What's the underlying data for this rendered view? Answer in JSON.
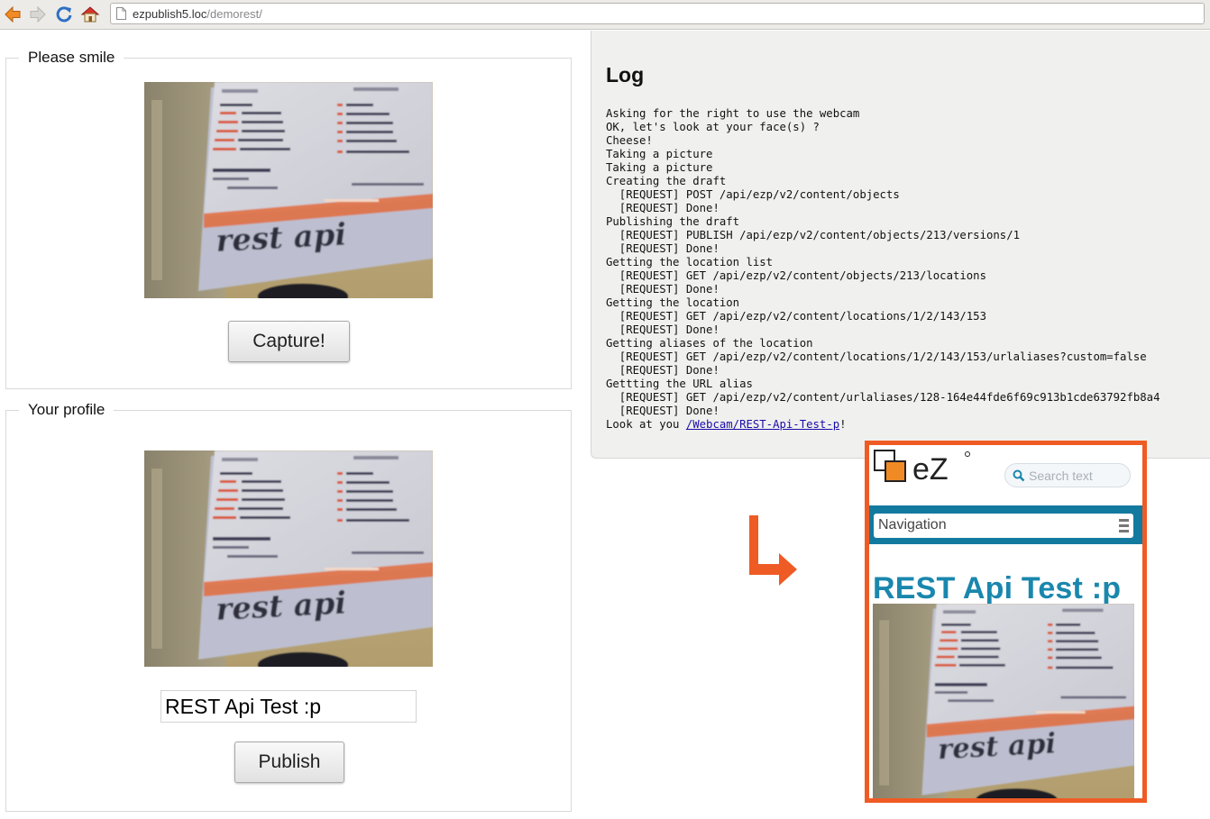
{
  "browser": {
    "url_host": "ezpublish5.loc",
    "url_path": "/demorest/"
  },
  "capture": {
    "legend": "Please smile",
    "button_label": "Capture!"
  },
  "profile": {
    "legend": "Your profile",
    "name_value": "REST Api Test :p",
    "button_label": "Publish"
  },
  "photo_text": {
    "rest_api": "rest api",
    "resources_heading": "Resources example",
    "content_type_heading": "Content type negociation"
  },
  "log": {
    "title": "Log",
    "lines": [
      "Asking for the right to use the webcam",
      "OK, let's look at your face(s) ?",
      "Cheese!",
      "Taking a picture",
      "Taking a picture",
      "Creating the draft",
      "  [REQUEST] POST /api/ezp/v2/content/objects",
      "  [REQUEST] Done!",
      "Publishing the draft",
      "  [REQUEST] PUBLISH /api/ezp/v2/content/objects/213/versions/1",
      "  [REQUEST] Done!",
      "Getting the location list",
      "  [REQUEST] GET /api/ezp/v2/content/objects/213/locations",
      "  [REQUEST] Done!",
      "Getting the location",
      "  [REQUEST] GET /api/ezp/v2/content/locations/1/2/143/153",
      "  [REQUEST] Done!",
      "Getting aliases of the location",
      "  [REQUEST] GET /api/ezp/v2/content/locations/1/2/143/153/urlaliases?custom=false",
      "  [REQUEST] Done!",
      "Gettting the URL alias",
      "  [REQUEST] GET /api/ezp/v2/content/urlaliases/128-164e44fde6f69c913b1cde63792fb8a4",
      "  [REQUEST] Done!"
    ],
    "final_prefix": "Look at you ",
    "final_link": "/Webcam/REST-Api-Test-p",
    "final_suffix": "!"
  },
  "ez_preview": {
    "logo_text": "eZ",
    "search_placeholder": "Search text",
    "nav_label": "Navigation",
    "title": "REST Api Test :p"
  },
  "colors": {
    "accent_orange": "#ef5b24",
    "ez_blue": "#1a87ad",
    "ez_nav": "#137a9f",
    "link": "#1a0dab"
  }
}
